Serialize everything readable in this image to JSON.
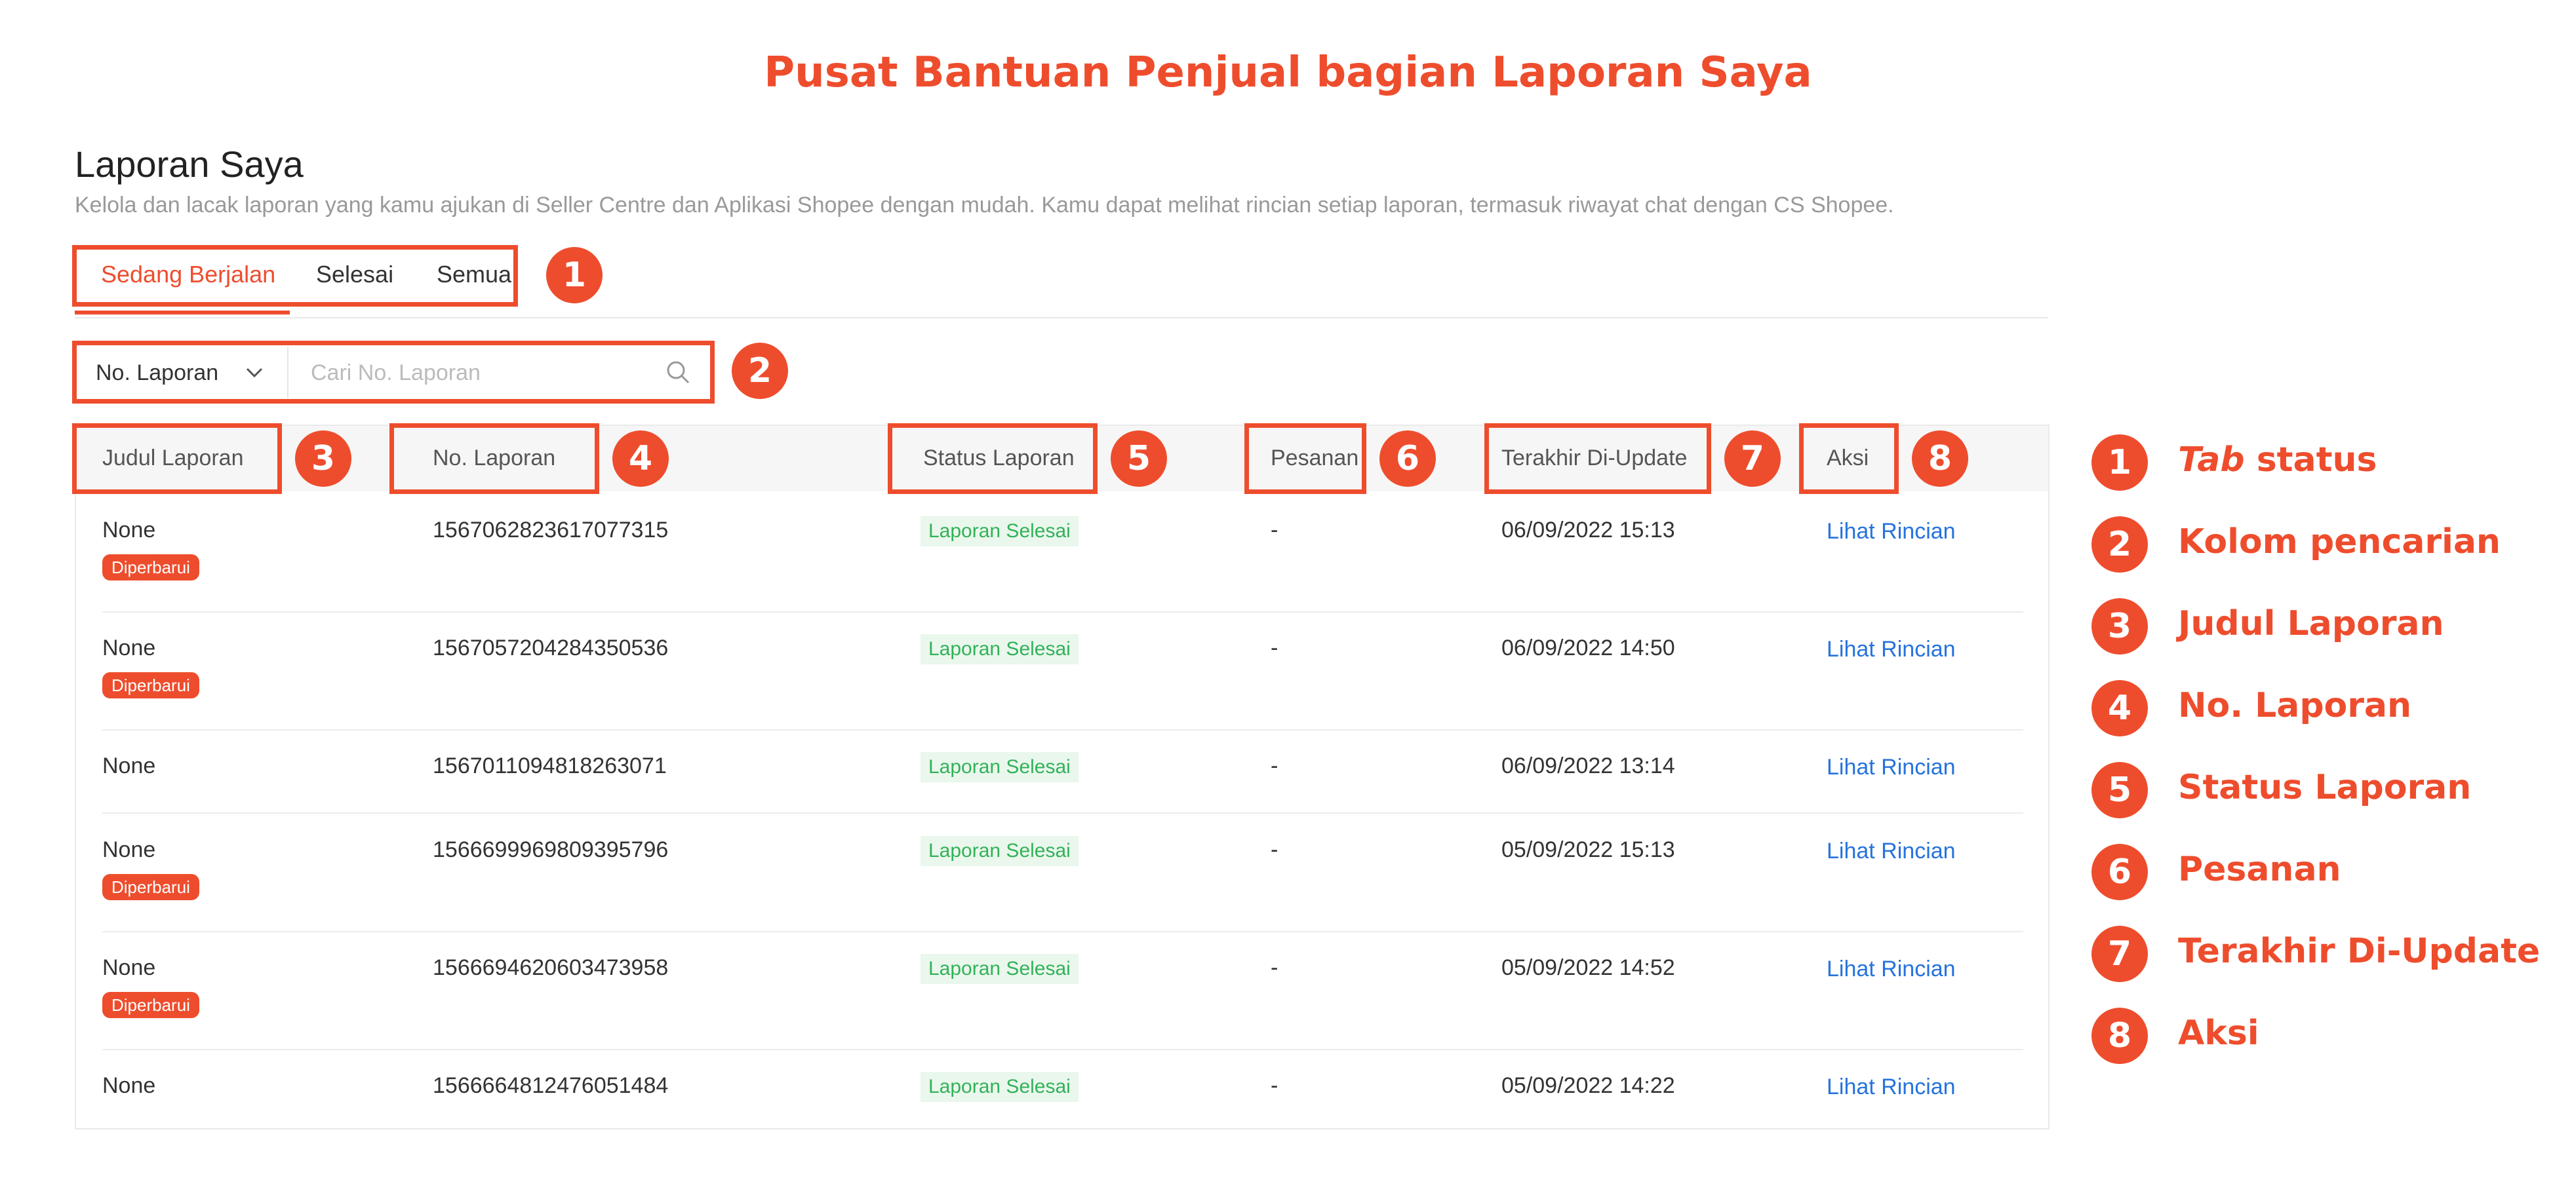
{
  "header_title": "Pusat Bantuan Penjual bagian Laporan Saya",
  "page": {
    "title": "Laporan Saya",
    "description": "Kelola dan lacak laporan yang kamu ajukan di Seller Centre dan Aplikasi Shopee dengan mudah. Kamu dapat melihat rincian setiap laporan, termasuk riwayat chat dengan CS Shopee."
  },
  "tabs": [
    "Sedang Berjalan",
    "Selesai",
    "Semua"
  ],
  "search": {
    "select_label": "No. Laporan",
    "placeholder": "Cari No. Laporan"
  },
  "table": {
    "columns": [
      "Judul Laporan",
      "No. Laporan",
      "Status Laporan",
      "Pesanan",
      "Terakhir Di-Update",
      "Aksi"
    ],
    "rows": [
      {
        "title": "None",
        "updated_tag": "Diperbarui",
        "number": "1567062823617077315",
        "status": "Laporan Selesai",
        "order": "-",
        "last_update": "06/09/2022 15:13",
        "action": "Lihat Rincian"
      },
      {
        "title": "None",
        "updated_tag": "Diperbarui",
        "number": "1567057204284350536",
        "status": "Laporan Selesai",
        "order": "-",
        "last_update": "06/09/2022 14:50",
        "action": "Lihat Rincian"
      },
      {
        "title": "None",
        "updated_tag": null,
        "number": "1567011094818263071",
        "status": "Laporan Selesai",
        "order": "-",
        "last_update": "06/09/2022 13:14",
        "action": "Lihat Rincian"
      },
      {
        "title": "None",
        "updated_tag": "Diperbarui",
        "number": "1566699969809395796",
        "status": "Laporan Selesai",
        "order": "-",
        "last_update": "05/09/2022 15:13",
        "action": "Lihat Rincian"
      },
      {
        "title": "None",
        "updated_tag": "Diperbarui",
        "number": "1566694620603473958",
        "status": "Laporan Selesai",
        "order": "-",
        "last_update": "05/09/2022 14:52",
        "action": "Lihat Rincian"
      },
      {
        "title": "None",
        "updated_tag": null,
        "number": "1566664812476051484",
        "status": "Laporan Selesai",
        "order": "-",
        "last_update": "05/09/2022 14:22",
        "action": "Lihat Rincian"
      }
    ]
  },
  "callout_numbers": [
    "1",
    "2",
    "3",
    "4",
    "5",
    "6",
    "7",
    "8"
  ],
  "legend": [
    {
      "num": "1",
      "label_italic": "Tab",
      "label": " status"
    },
    {
      "num": "2",
      "label": "Kolom pencarian"
    },
    {
      "num": "3",
      "label": "Judul Laporan"
    },
    {
      "num": "4",
      "label": "No. Laporan"
    },
    {
      "num": "5",
      "label": "Status Laporan"
    },
    {
      "num": "6",
      "label": "Pesanan"
    },
    {
      "num": "7",
      "label": "Terakhir Di-Update"
    },
    {
      "num": "8",
      "label": "Aksi"
    }
  ],
  "colors": {
    "accent": "#ee4d2d",
    "link": "#2673dd",
    "status_text": "#32b25a",
    "status_bg": "#eaf7ec"
  },
  "icons": {
    "dropdown": "chevron-down-icon",
    "search": "search-icon"
  }
}
